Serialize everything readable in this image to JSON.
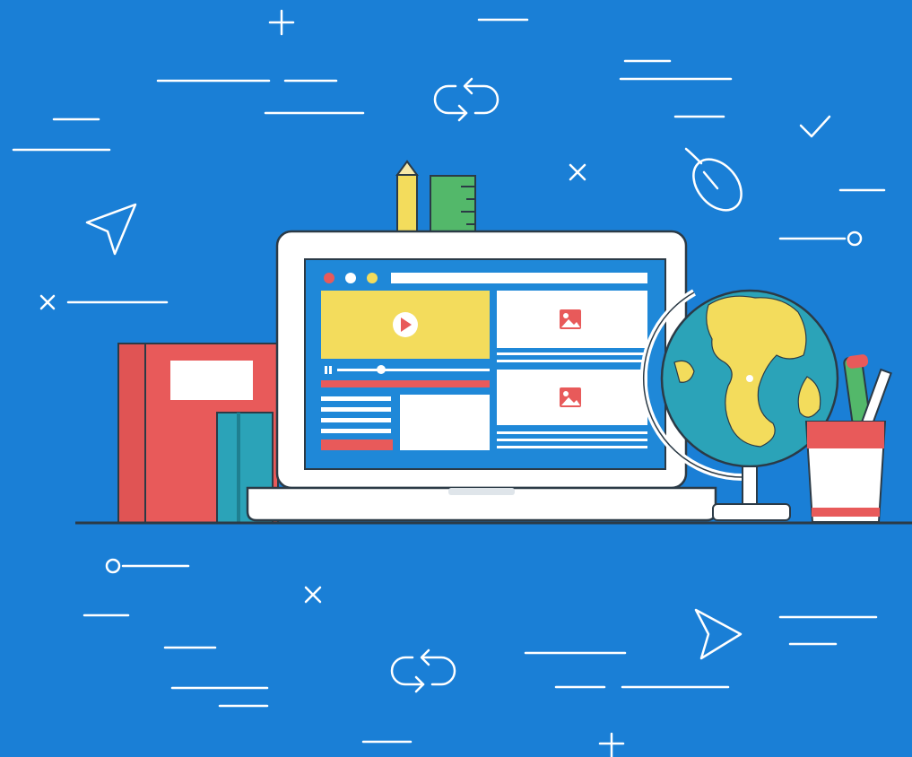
{
  "scene": {
    "background_color": "#1a7fd6",
    "line_color": "#ffffff",
    "accent_red": "#e85a5a",
    "accent_yellow": "#f3dc5c",
    "accent_green": "#53b86a",
    "accent_teal": "#2ba3b8",
    "outline_dark": "#2b3a46"
  },
  "laptop": {
    "screen_blue": "#1f88d8",
    "video_panel_color": "#f3dc5c",
    "progress_color": "#e85a5a",
    "icons": [
      "play-icon",
      "image-icon",
      "image-icon"
    ]
  },
  "decor_icons": [
    "plus-icon",
    "refresh-icon",
    "check-icon",
    "mouse-icon",
    "close-icon",
    "send-arrow-icon",
    "circle-line-icon"
  ]
}
